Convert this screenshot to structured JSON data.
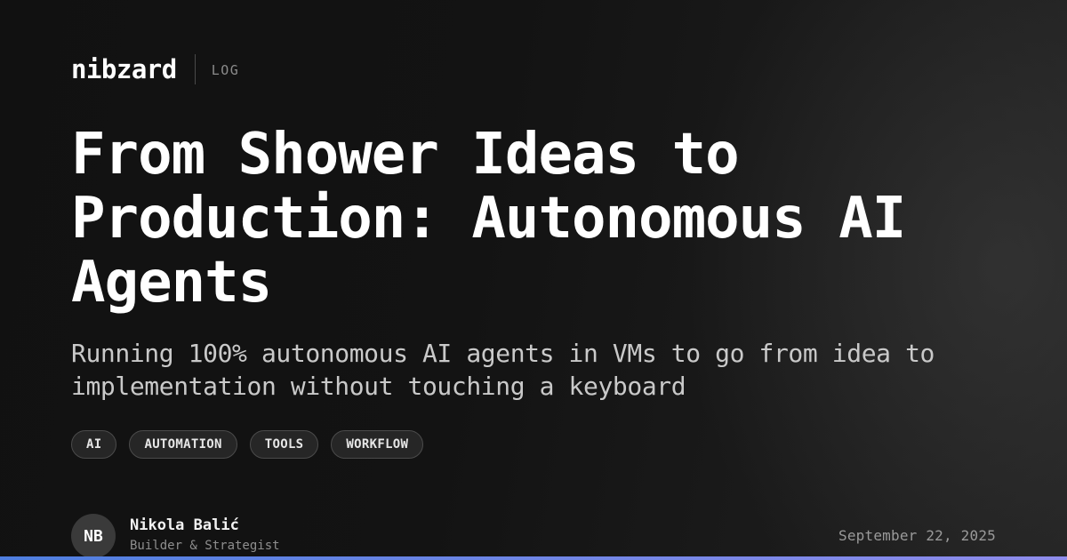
{
  "brand": {
    "name": "nibzard",
    "section": "LOG"
  },
  "post": {
    "title": "From Shower Ideas to Production: Autonomous AI Agents",
    "subtitle": "Running 100% autonomous AI agents in VMs to go from idea to implementation without touching a keyboard",
    "tags": [
      "AI",
      "AUTOMATION",
      "TOOLS",
      "WORKFLOW"
    ],
    "date": "September 22, 2025"
  },
  "author": {
    "initials": "NB",
    "name": "Nikola Balić",
    "role": "Builder & Strategist"
  },
  "colors": {
    "background": "#141414",
    "text": "#ffffff",
    "muted": "#8c8c8c",
    "tag_background": "#262626",
    "accent_start": "#4f7fe0",
    "accent_end": "#8f8cec"
  }
}
